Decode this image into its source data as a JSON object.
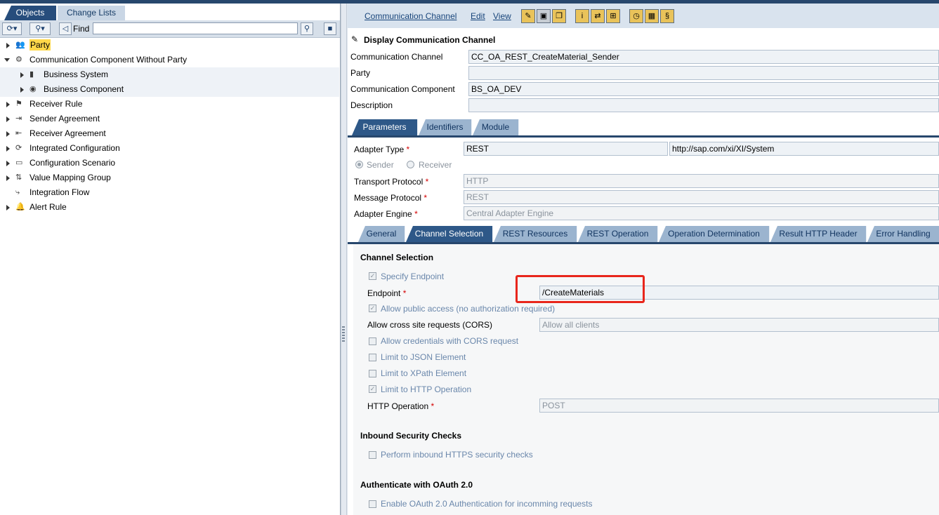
{
  "left_tabs": {
    "objects": "Objects",
    "change_lists": "Change Lists"
  },
  "left_toolbar": {
    "find_label": "Find",
    "find_value": ""
  },
  "tree": [
    {
      "label": "Party",
      "icon": "party-icon",
      "expanded": false,
      "indent": 0,
      "highlighted": true
    },
    {
      "label": "Communication Component Without Party",
      "icon": "communication-component-icon",
      "expanded": true,
      "indent": 0
    },
    {
      "label": "Business System",
      "icon": "business-system-icon",
      "expanded": false,
      "indent": 1
    },
    {
      "label": "Business Component",
      "icon": "business-component-icon",
      "expanded": false,
      "indent": 1
    },
    {
      "label": "Receiver Rule",
      "icon": "receiver-rule-icon",
      "expanded": false,
      "indent": 0
    },
    {
      "label": "Sender Agreement",
      "icon": "sender-agreement-icon",
      "expanded": false,
      "indent": 0
    },
    {
      "label": "Receiver Agreement",
      "icon": "receiver-agreement-icon",
      "expanded": false,
      "indent": 0
    },
    {
      "label": "Integrated Configuration",
      "icon": "integrated-configuration-icon",
      "expanded": false,
      "indent": 0
    },
    {
      "label": "Configuration Scenario",
      "icon": "configuration-scenario-icon",
      "expanded": false,
      "indent": 0
    },
    {
      "label": "Value Mapping Group",
      "icon": "value-mapping-group-icon",
      "expanded": false,
      "indent": 0
    },
    {
      "label": "Integration Flow",
      "icon": "integration-flow-icon",
      "expanded": null,
      "indent": 0
    },
    {
      "label": "Alert Rule",
      "icon": "alert-rule-icon",
      "expanded": false,
      "indent": 0
    }
  ],
  "menu": {
    "communication_channel": "Communication Channel",
    "edit": "Edit",
    "view": "View"
  },
  "header": {
    "title": "Display Communication Channel",
    "communication_channel_label": "Communication Channel",
    "communication_channel_value": "CC_OA_REST_CreateMaterial_Sender",
    "party_label": "Party",
    "party_value": "",
    "communication_component_label": "Communication Component",
    "communication_component_value": "BS_OA_DEV",
    "description_label": "Description",
    "description_value": ""
  },
  "main_tabs": [
    "Parameters",
    "Identifiers",
    "Module"
  ],
  "parameters": {
    "adapter_type_label": "Adapter Type",
    "adapter_type_value": "REST",
    "adapter_namespace": "http://sap.com/xi/XI/System",
    "sender_label": "Sender",
    "receiver_label": "Receiver",
    "transport_protocol_label": "Transport Protocol",
    "transport_protocol_value": "HTTP",
    "message_protocol_label": "Message Protocol",
    "message_protocol_value": "REST",
    "adapter_engine_label": "Adapter Engine",
    "adapter_engine_value": "Central Adapter Engine",
    "required_mark": "*"
  },
  "sub_tabs": [
    "General",
    "Channel Selection",
    "REST Resources",
    "REST Operation",
    "Operation Determination",
    "Result HTTP Header",
    "Error Handling"
  ],
  "channel_selection": {
    "section_title": "Channel Selection",
    "specify_endpoint_label": "Specify Endpoint",
    "endpoint_label": "Endpoint",
    "endpoint_value": "/CreateMaterials",
    "allow_public_access_label": "Allow public access (no authorization required)",
    "cors_label": "Allow cross site requests (CORS)",
    "cors_value": "Allow all clients",
    "allow_credentials_label": "Allow credentials with CORS request",
    "limit_json_label": "Limit to JSON Element",
    "limit_xpath_label": "Limit to XPath Element",
    "limit_http_label": "Limit to HTTP Operation",
    "http_operation_label": "HTTP Operation",
    "http_operation_value": "POST"
  },
  "inbound_security": {
    "section_title": "Inbound Security Checks",
    "perform_https_label": "Perform inbound HTTPS security checks"
  },
  "oauth": {
    "section_title": "Authenticate with OAuth 2.0",
    "enable_oauth_label": "Enable OAuth 2.0 Authentication for incomming requests"
  },
  "colors": {
    "accent": "#27476d",
    "tab_active": "#2e5888",
    "tab_inactive": "#9bb4cf",
    "highlight_box": "#e8261c"
  }
}
